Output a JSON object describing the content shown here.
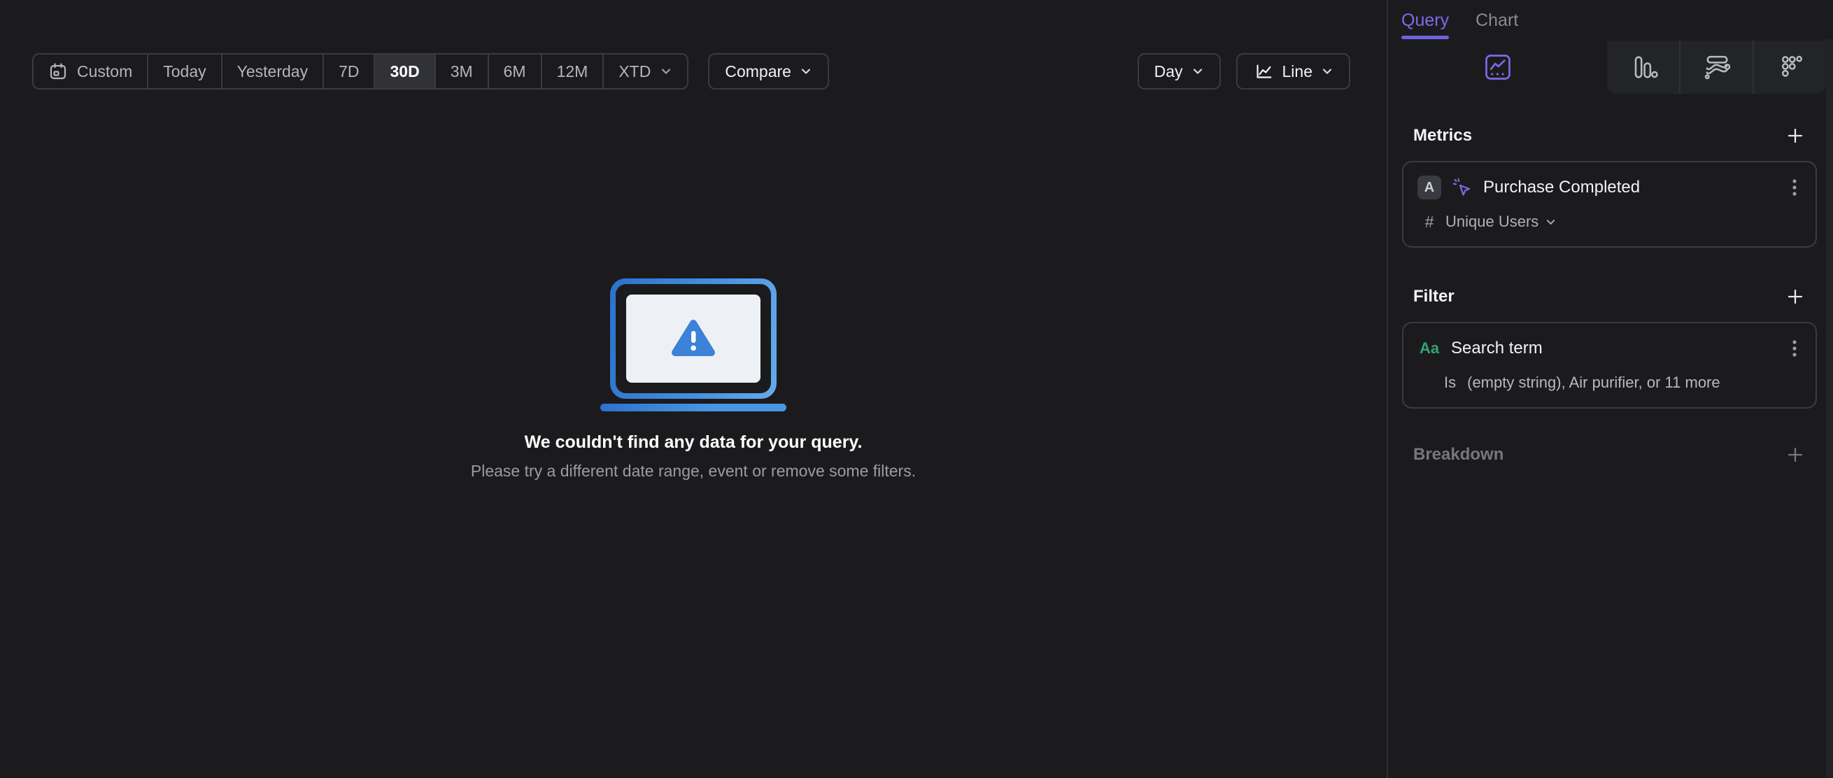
{
  "toolbar": {
    "date_ranges": [
      {
        "label": "Custom",
        "icon": "calendar",
        "selected": false
      },
      {
        "label": "Today",
        "selected": false
      },
      {
        "label": "Yesterday",
        "selected": false
      },
      {
        "label": "7D",
        "selected": false
      },
      {
        "label": "30D",
        "selected": true
      },
      {
        "label": "3M",
        "selected": false
      },
      {
        "label": "6M",
        "selected": false
      },
      {
        "label": "12M",
        "selected": false
      },
      {
        "label": "XTD",
        "selected": false,
        "has_dropdown": true
      }
    ],
    "compare": {
      "label": "Compare",
      "has_dropdown": true
    },
    "granularity": {
      "label": "Day",
      "has_dropdown": true
    },
    "chart_type": {
      "label": "Line",
      "icon": "line-chart",
      "has_dropdown": true
    }
  },
  "sidebar": {
    "tabs": [
      {
        "label": "Query",
        "active": true
      },
      {
        "label": "Chart",
        "active": false
      }
    ],
    "view_tabs": [
      {
        "name": "insights",
        "active": true
      },
      {
        "name": "funnel",
        "active": false
      },
      {
        "name": "flow",
        "active": false
      },
      {
        "name": "retention",
        "active": false
      }
    ],
    "metrics": {
      "title": "Metrics",
      "items": [
        {
          "letter": "A",
          "icon": "event-click",
          "name": "Purchase Completed",
          "aggregation_prefix": "#",
          "aggregation": "Unique Users"
        }
      ]
    },
    "filter": {
      "title": "Filter",
      "items": [
        {
          "type_label": "Aa",
          "name": "Search term",
          "operator": "Is",
          "value": "(empty string), Air purifier, or 11 more"
        }
      ]
    },
    "breakdown": {
      "title": "Breakdown"
    }
  },
  "empty_state": {
    "title": "We couldn't find any data for your query.",
    "subtitle": "Please try a different date range, event or remove some filters."
  },
  "colors": {
    "background": "#1b1b1e",
    "accent_purple": "#7b6ce8",
    "string_green": "#31a571",
    "illustration_blue": "#3b82d8",
    "illustration_blue_light": "#66a9ec",
    "screen_light": "#edf1f5",
    "border": "#3a3b40"
  }
}
